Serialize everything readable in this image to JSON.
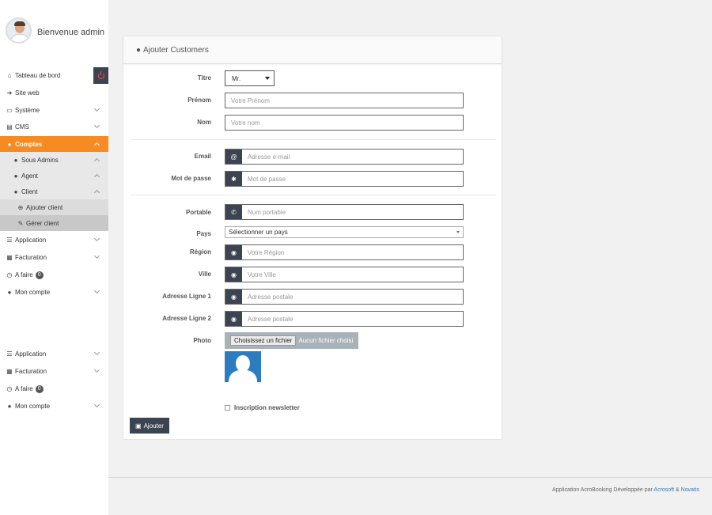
{
  "user": {
    "welcome": "Bienvenue admin"
  },
  "sidebar": {
    "items": [
      {
        "label": "Tableau de bord",
        "icon": "home-icon"
      },
      {
        "label": "Site web",
        "icon": "sign-in-icon"
      },
      {
        "label": "Système",
        "icon": "laptop-icon"
      },
      {
        "label": "CMS",
        "icon": "card-icon"
      },
      {
        "label": "Comptes",
        "icon": "user-icon"
      },
      {
        "label": "Sous Admins",
        "icon": "user-icon"
      },
      {
        "label": "Agent",
        "icon": "user-icon"
      },
      {
        "label": "Client",
        "icon": "user-icon"
      },
      {
        "label": "Ajouter client",
        "icon": "plus-circle-icon"
      },
      {
        "label": "Gérer client",
        "icon": "edit-icon"
      },
      {
        "label": "Application",
        "icon": "list-icon"
      },
      {
        "label": "Facturation",
        "icon": "file-icon"
      },
      {
        "label": "A faire",
        "icon": "clock-icon",
        "badge": "0"
      },
      {
        "label": "Mon compte",
        "icon": "user-icon"
      },
      {
        "label": "Application",
        "icon": "list-icon"
      },
      {
        "label": "Facturation",
        "icon": "file-icon"
      },
      {
        "label": "A faire",
        "icon": "clock-icon",
        "badge": "0"
      },
      {
        "label": "Mon compte",
        "icon": "user-icon"
      }
    ]
  },
  "form": {
    "title": "Ajouter Customers",
    "titre": {
      "label": "Titre",
      "value": "Mr."
    },
    "prenom": {
      "label": "Prénom",
      "placeholder": "Votre Prénom"
    },
    "nom": {
      "label": "Nom",
      "placeholder": "Votre nom"
    },
    "email": {
      "label": "Email",
      "placeholder": "Adresse e-mail",
      "addon": "@"
    },
    "password": {
      "label": "Mot de passe",
      "placeholder": "Mot de passe",
      "addon": "✱"
    },
    "portable": {
      "label": "Portable",
      "placeholder": "Num portable"
    },
    "pays": {
      "label": "Pays",
      "value": "Sélectionner un pays"
    },
    "region": {
      "label": "Région",
      "placeholder": "Votre Région"
    },
    "ville": {
      "label": "Ville",
      "placeholder": "Votre Ville"
    },
    "adresse1": {
      "label": "Adresse Ligne 1",
      "placeholder": "Adresse postale"
    },
    "adresse2": {
      "label": "Adresse Ligne 2",
      "placeholder": "Adresse postale"
    },
    "photo": {
      "label": "Photo",
      "button": "Choisissez un fichier",
      "status": "Aucun fichier choisi"
    },
    "newsletter": {
      "label": "Inscription newsletter"
    },
    "submit": "Ajouter"
  },
  "footer": {
    "text": "Application AcroBooking Développée par ",
    "link1": "Acrosoft",
    "amp": " & ",
    "link2": "Novatis"
  },
  "colors": {
    "accent": "#f58b22",
    "dark": "#3d4451",
    "photo": "#2c7dbf",
    "link": "#3a7bb5"
  }
}
